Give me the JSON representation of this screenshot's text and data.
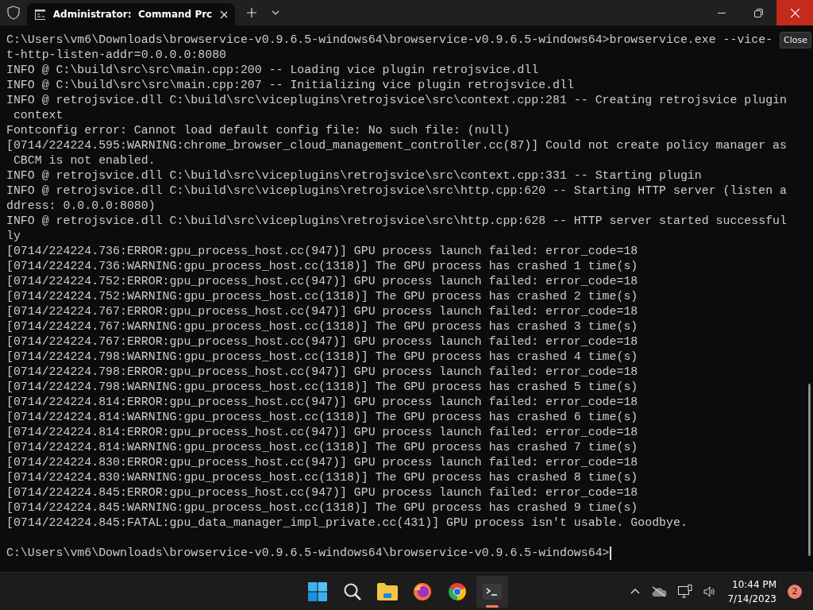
{
  "tab": {
    "title": "Administrator:  Command Prc",
    "selected": true
  },
  "tooltip": "Close",
  "lines": [
    "C:\\Users\\vm6\\Downloads\\browservice-v0.9.6.5-windows64\\browservice-v0.9.6.5-windows64>browservice.exe --vice-",
    "t-http-listen-addr=0.0.0.0:8080",
    "INFO @ C:\\build\\src\\src\\main.cpp:200 -- Loading vice plugin retrojsvice.dll",
    "INFO @ C:\\build\\src\\src\\main.cpp:207 -- Initializing vice plugin retrojsvice.dll",
    "INFO @ retrojsvice.dll C:\\build\\src\\viceplugins\\retrojsvice\\src\\context.cpp:281 -- Creating retrojsvice plugin",
    " context",
    "Fontconfig error: Cannot load default config file: No such file: (null)",
    "[0714/224224.595:WARNING:chrome_browser_cloud_management_controller.cc(87)] Could not create policy manager as",
    " CBCM is not enabled.",
    "INFO @ retrojsvice.dll C:\\build\\src\\viceplugins\\retrojsvice\\src\\context.cpp:331 -- Starting plugin",
    "INFO @ retrojsvice.dll C:\\build\\src\\viceplugins\\retrojsvice\\src\\http.cpp:620 -- Starting HTTP server (listen a",
    "ddress: 0.0.0.0:8080)",
    "INFO @ retrojsvice.dll C:\\build\\src\\viceplugins\\retrojsvice\\src\\http.cpp:628 -- HTTP server started successful",
    "ly",
    "[0714/224224.736:ERROR:gpu_process_host.cc(947)] GPU process launch failed: error_code=18",
    "[0714/224224.736:WARNING:gpu_process_host.cc(1318)] The GPU process has crashed 1 time(s)",
    "[0714/224224.752:ERROR:gpu_process_host.cc(947)] GPU process launch failed: error_code=18",
    "[0714/224224.752:WARNING:gpu_process_host.cc(1318)] The GPU process has crashed 2 time(s)",
    "[0714/224224.767:ERROR:gpu_process_host.cc(947)] GPU process launch failed: error_code=18",
    "[0714/224224.767:WARNING:gpu_process_host.cc(1318)] The GPU process has crashed 3 time(s)",
    "[0714/224224.767:ERROR:gpu_process_host.cc(947)] GPU process launch failed: error_code=18",
    "[0714/224224.798:WARNING:gpu_process_host.cc(1318)] The GPU process has crashed 4 time(s)",
    "[0714/224224.798:ERROR:gpu_process_host.cc(947)] GPU process launch failed: error_code=18",
    "[0714/224224.798:WARNING:gpu_process_host.cc(1318)] The GPU process has crashed 5 time(s)",
    "[0714/224224.814:ERROR:gpu_process_host.cc(947)] GPU process launch failed: error_code=18",
    "[0714/224224.814:WARNING:gpu_process_host.cc(1318)] The GPU process has crashed 6 time(s)",
    "[0714/224224.814:ERROR:gpu_process_host.cc(947)] GPU process launch failed: error_code=18",
    "[0714/224224.814:WARNING:gpu_process_host.cc(1318)] The GPU process has crashed 7 time(s)",
    "[0714/224224.830:ERROR:gpu_process_host.cc(947)] GPU process launch failed: error_code=18",
    "[0714/224224.830:WARNING:gpu_process_host.cc(1318)] The GPU process has crashed 8 time(s)",
    "[0714/224224.845:ERROR:gpu_process_host.cc(947)] GPU process launch failed: error_code=18",
    "[0714/224224.845:WARNING:gpu_process_host.cc(1318)] The GPU process has crashed 9 time(s)",
    "[0714/224224.845:FATAL:gpu_data_manager_impl_private.cc(431)] GPU process isn't usable. Goodbye."
  ],
  "prompt": "C:\\Users\\vm6\\Downloads\\browservice-v0.9.6.5-windows64\\browservice-v0.9.6.5-windows64>",
  "taskbar": {
    "apps": [
      {
        "kind": "start",
        "selected": false
      },
      {
        "kind": "search",
        "selected": false
      },
      {
        "kind": "folder",
        "selected": false
      },
      {
        "kind": "firefox",
        "selected": false
      },
      {
        "kind": "chrome",
        "selected": false
      },
      {
        "kind": "terminal",
        "selected": true
      }
    ],
    "time": "10:44 PM",
    "date": "7/14/2023",
    "notifications": "2"
  }
}
